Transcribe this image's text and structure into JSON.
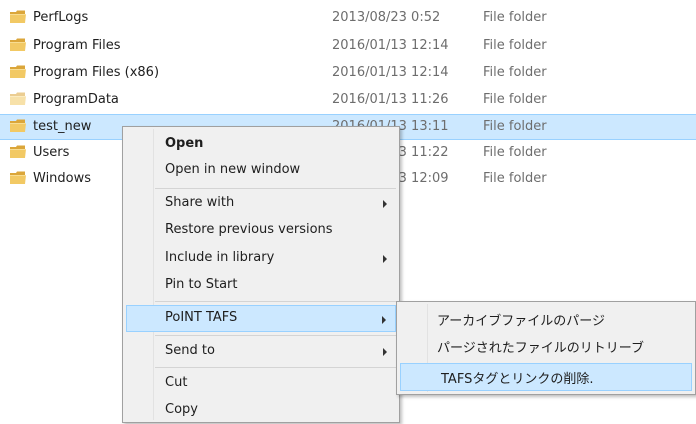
{
  "files": [
    {
      "name": "PerfLogs",
      "date": "2013/08/23 0:52",
      "type": "File folder"
    },
    {
      "name": "Program Files",
      "date": "2016/01/13 12:14",
      "type": "File folder"
    },
    {
      "name": "Program Files (x86)",
      "date": "2016/01/13 12:14",
      "type": "File folder"
    },
    {
      "name": "ProgramData",
      "date": "2016/01/13 11:26",
      "type": "File folder"
    },
    {
      "name": "test_new",
      "date": "2016/01/13 13:11",
      "type": "File folder"
    },
    {
      "name": "Users",
      "date": "2016/01/13 11:22",
      "type": "File folder"
    },
    {
      "name": "Windows",
      "date": "2016/01/13 12:09",
      "type": "File folder"
    }
  ],
  "context_menu": {
    "open": "Open",
    "open_new_window": "Open in new window",
    "share_with": "Share with",
    "restore_previous_versions": "Restore previous versions",
    "include_in_library": "Include in library",
    "pin_to_start": "Pin to Start",
    "point_tafs": "PoINT TAFS",
    "send_to": "Send to",
    "cut": "Cut",
    "copy": "Copy"
  },
  "submenu": {
    "archive_purge": "アーカイブファイルのパージ",
    "retrieve_purged": "パージされたファイルのリトリーブ",
    "delete_tags_links": "TAFSタグとリンクの削除."
  },
  "colors": {
    "selection_bg": "#cce8ff",
    "selection_border": "#99d1ff",
    "menu_bg": "#f0f0f0",
    "folder_yellow": "#e8b84a"
  }
}
